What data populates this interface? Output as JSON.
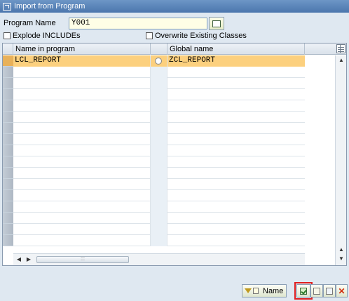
{
  "window": {
    "title": "Import from Program"
  },
  "form": {
    "program_name_label": "Program Name",
    "program_name_value": "Y001",
    "explode_includes_label": "Explode INCLUDEs",
    "overwrite_label": "Overwrite Existing Classes"
  },
  "table": {
    "headers": [
      "Name in program",
      "Global name"
    ],
    "rows": [
      {
        "name": "LCL_REPORT",
        "global": "ZCL_REPORT"
      }
    ]
  },
  "footer": {
    "sort_button_label": "Name"
  }
}
